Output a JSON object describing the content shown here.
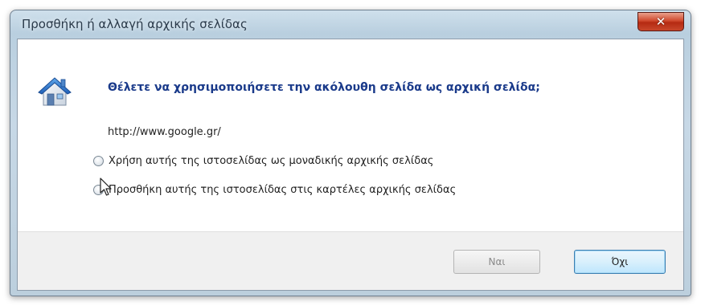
{
  "window": {
    "title": "Προσθήκη ή αλλαγή αρχικής σελίδας",
    "close_glyph": "✕"
  },
  "dialog": {
    "question": "Θέλετε να χρησιμοποιήσετε την ακόλουθη σελίδα ως αρχική σελίδα;",
    "url": "http://www.google.gr/",
    "options": [
      {
        "label": "Χρήση αυτής της ιστοσελίδας ως μοναδικής αρχικής σελίδας",
        "selected": false
      },
      {
        "label": "Προσθήκη αυτής της ιστοσελίδας στις καρτέλες αρχικής σελίδας",
        "selected": false
      }
    ]
  },
  "buttons": {
    "yes_label": "Ναι",
    "no_label": "Όχι"
  },
  "icons": {
    "home": "home-page-icon",
    "close": "close-icon",
    "cursor": "mouse-pointer-icon"
  },
  "colors": {
    "question_text": "#1a3a8a",
    "close_button": "#c8472b",
    "default_button_border": "#3c7fb1"
  }
}
